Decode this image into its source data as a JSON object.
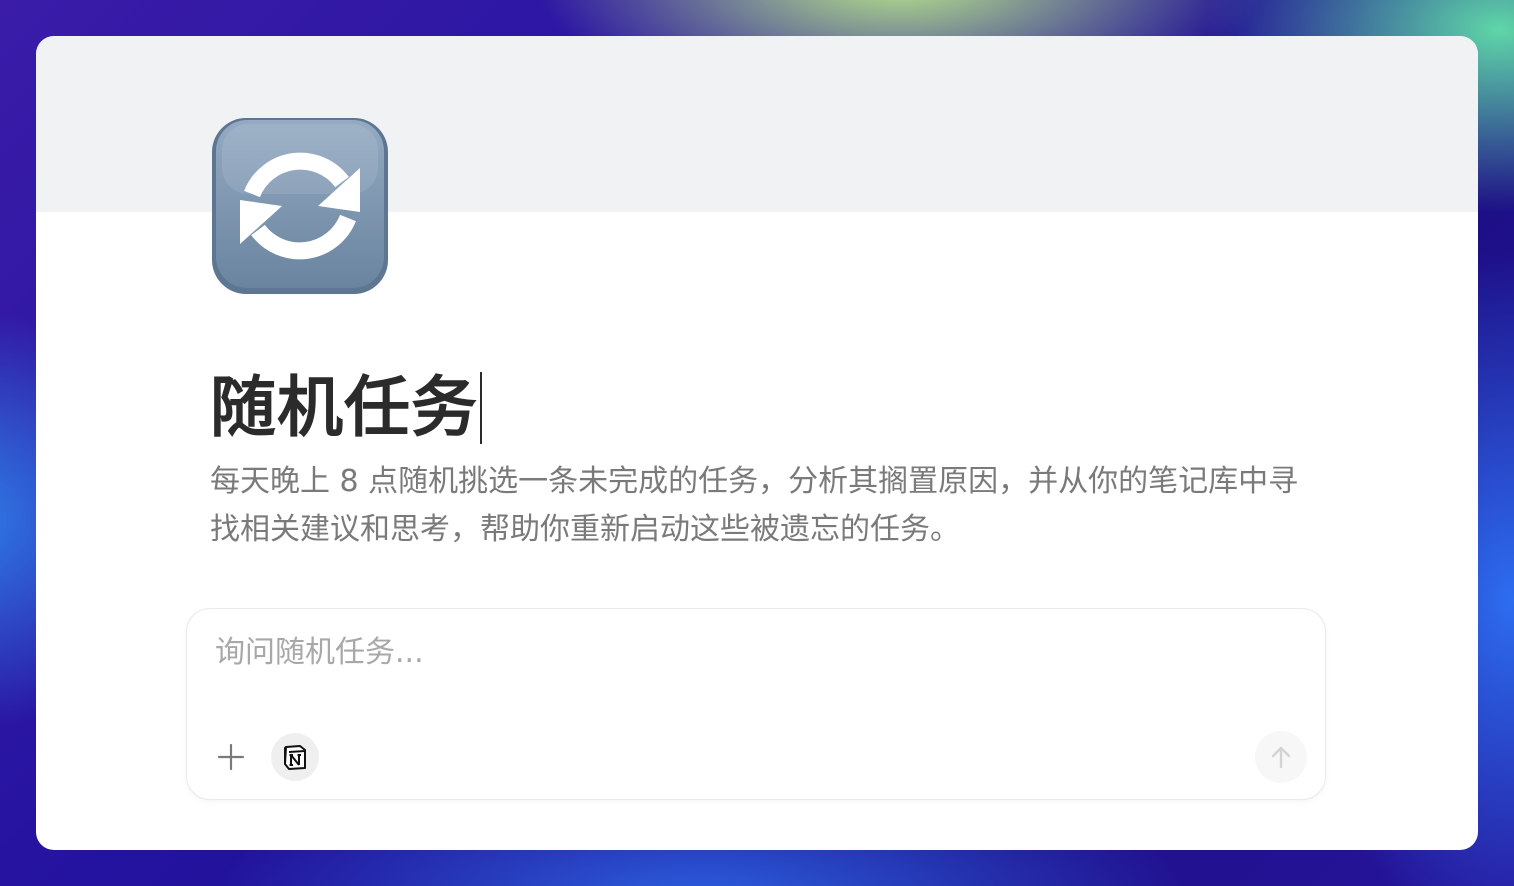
{
  "page": {
    "icon": "refresh-arrows-icon",
    "title": "随机任务",
    "description": "每天晚上 8 点随机挑选一条未完成的任务，分析其搁置原因，并从你的笔记库中寻找相关建议和思考，帮助你重新启动这些被遗忘的任务。"
  },
  "chat": {
    "placeholder": "询问随机任务...",
    "value": "",
    "add_icon": "plus-icon",
    "integration_icon": "notion-logo-icon",
    "send_icon": "arrow-up-icon"
  },
  "colors": {
    "card_background": "#ffffff",
    "cover_background": "#f1f2f4",
    "title": "#2b2b2b",
    "description": "#7a7a7a",
    "placeholder": "#a8a8a8",
    "icon_tile": "#7a93ad"
  }
}
